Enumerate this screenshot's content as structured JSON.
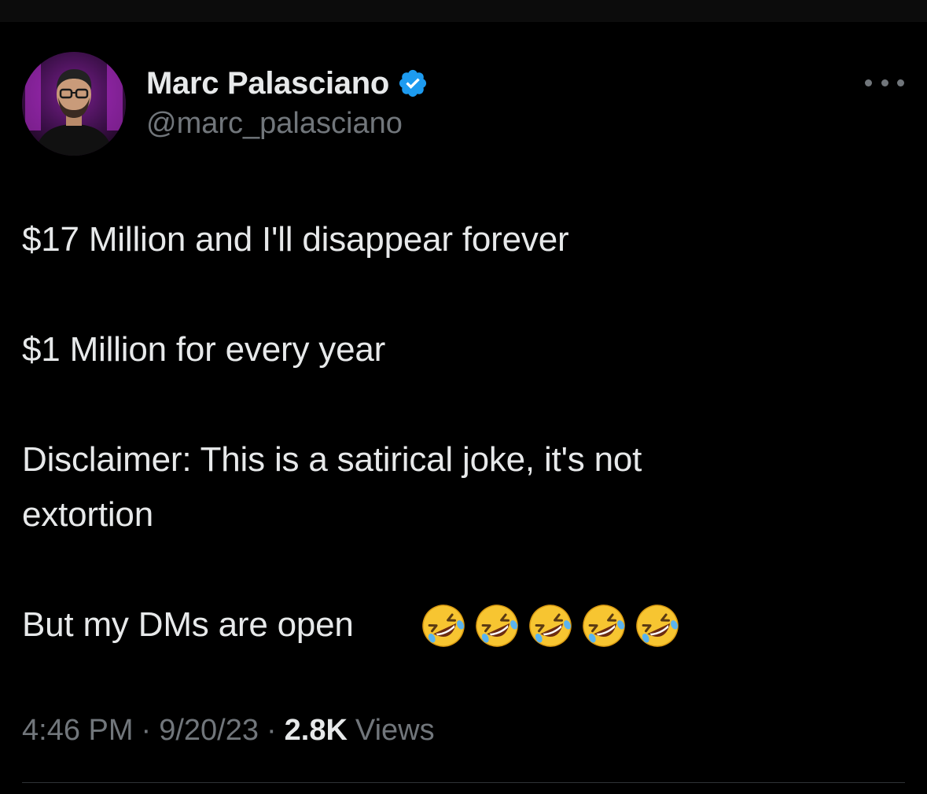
{
  "author": {
    "name": "Marc Palasciano",
    "handle": "@marc_palasciano",
    "verified": true,
    "verified_color": "#1d9bf0"
  },
  "tweet": {
    "lines": [
      "$17 Million and I'll disappear forever",
      "$1 Million for every year",
      "Disclaimer: This is a satirical joke, it's not",
      "extortion",
      "But my DMs are open"
    ],
    "emojis": [
      "rolling-on-floor-laughing",
      "rolling-on-floor-laughing",
      "rolling-on-floor-laughing",
      "rolling-on-floor-laughing",
      "rolling-on-floor-laughing"
    ]
  },
  "meta": {
    "time": "4:46 PM",
    "separator": "·",
    "date": "9/20/23",
    "views_count": "2.8K",
    "views_label": "Views"
  },
  "colors": {
    "background": "#000000",
    "primary_text": "#e7e9ea",
    "secondary_text": "#71767b",
    "divider": "#2f3336"
  },
  "icons": {
    "more": "more-horizontal-icon",
    "verified": "verified-badge-icon"
  }
}
